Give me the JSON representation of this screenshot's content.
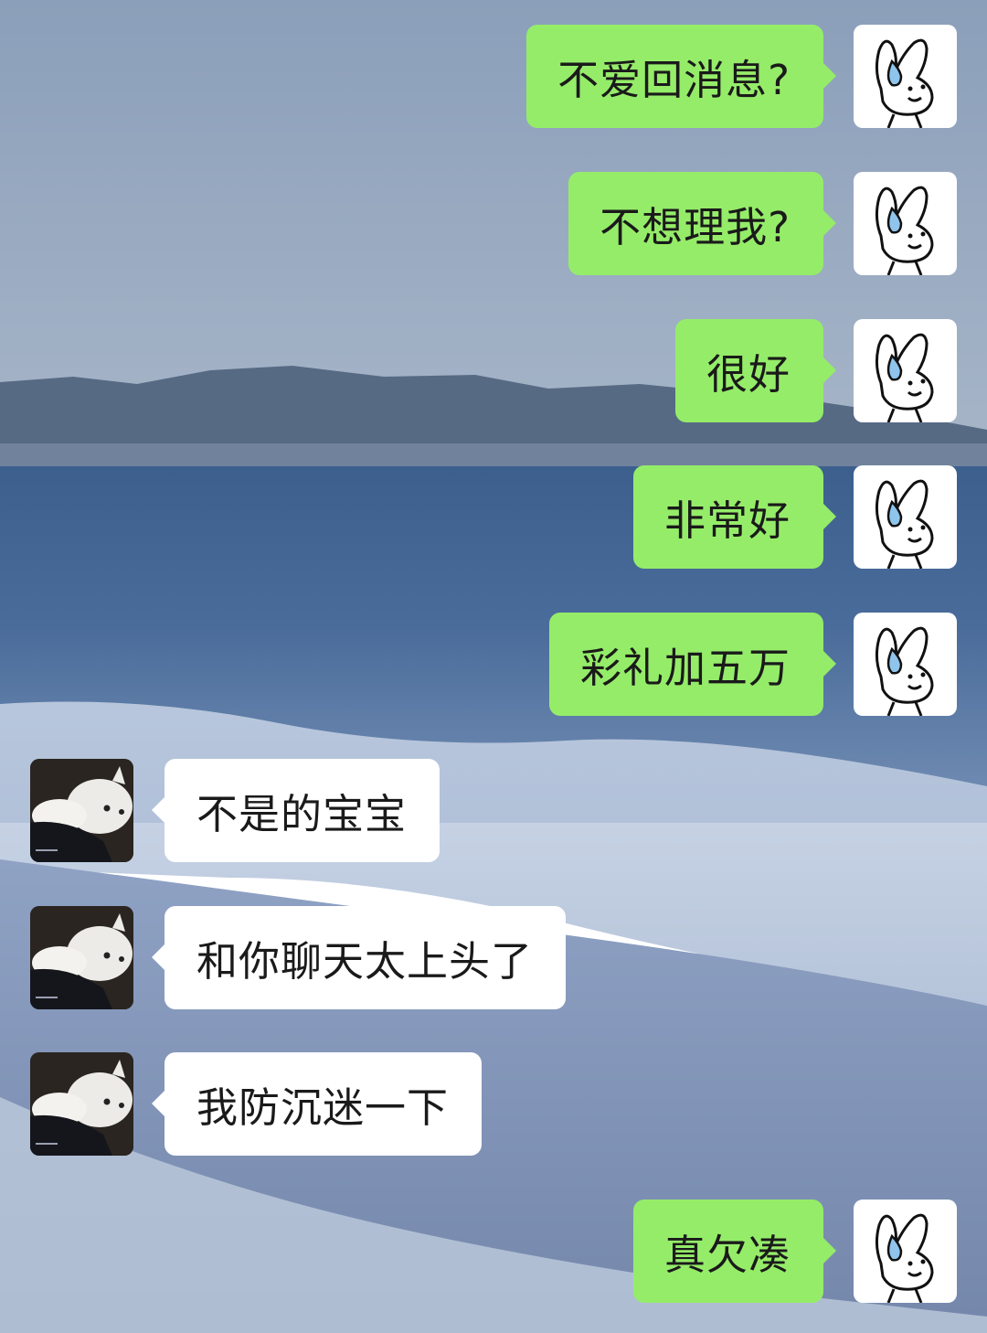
{
  "conversation": {
    "messages": [
      {
        "sender": "me",
        "text": "不爱回消息?"
      },
      {
        "sender": "me",
        "text": "不想理我?"
      },
      {
        "sender": "me",
        "text": "很好"
      },
      {
        "sender": "me",
        "text": "非常好"
      },
      {
        "sender": "me",
        "text": "彩礼加五万"
      },
      {
        "sender": "them",
        "text": "不是的宝宝"
      },
      {
        "sender": "them",
        "text": "和你聊天太上头了"
      },
      {
        "sender": "them",
        "text": "我防沉迷一下"
      },
      {
        "sender": "me",
        "text": "真欠凑"
      }
    ]
  },
  "avatars": {
    "me": "rabbit-sweat-drop-icon",
    "them": "white-cat-photo"
  },
  "colors": {
    "my_bubble": "#95ec69",
    "their_bubble": "#ffffff",
    "text": "#1a1a1a",
    "sweat_drop": "#8fc4ec"
  }
}
